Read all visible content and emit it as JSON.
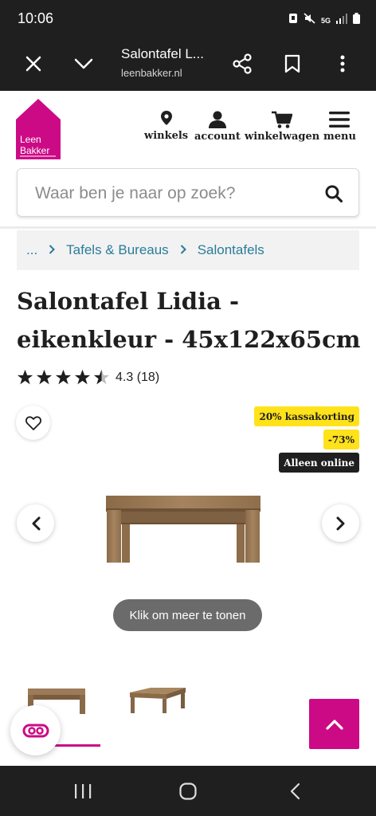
{
  "status_bar": {
    "time": "10:06",
    "network": "5G"
  },
  "browser": {
    "title": "Salontafel L...",
    "domain": "leenbakker.nl",
    "icons": [
      "close-icon",
      "chevron-down-icon",
      "share-icon",
      "bookmark-icon",
      "more-vert-icon"
    ]
  },
  "header": {
    "logo_line1": "Leen",
    "logo_line2": "Bakker",
    "nav": [
      {
        "label": "winkels",
        "icon": "location-pin-icon"
      },
      {
        "label": "account",
        "icon": "user-icon"
      },
      {
        "label": "winkelwagen",
        "icon": "cart-icon"
      },
      {
        "label": "menu",
        "icon": "hamburger-icon"
      }
    ]
  },
  "search": {
    "placeholder": "Waar ben je naar op zoek?"
  },
  "breadcrumb": {
    "ellipsis": "...",
    "items": [
      "Tafels & Bureaus",
      "Salontafels"
    ]
  },
  "product": {
    "title_line1": "Salontafel Lidia -",
    "title_line2": "eikenkleur - 45x122x65cm",
    "rating_value": 4.3,
    "rating_text": "4.3 (18)",
    "badges": [
      "20% kassakorting",
      "-73%",
      "Alleen online"
    ],
    "more_button": "Klik om meer te tonen"
  },
  "colors": {
    "brand_pink": "#cc0a86",
    "badge_yellow": "#ffe21a",
    "link_blue": "#2a7c9a",
    "dark": "#1f1f1f"
  }
}
